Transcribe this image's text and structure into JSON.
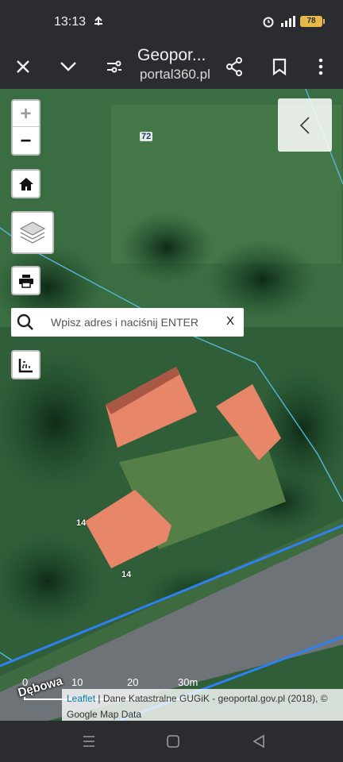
{
  "status_bar": {
    "time": "13:13",
    "battery": "78"
  },
  "toolbar": {
    "title": "Geopor...",
    "url": "portal360.pl"
  },
  "map": {
    "zoom_in": "+",
    "zoom_out": "−",
    "search": {
      "placeholder": "Wpisz adres i naciśnij ENTER",
      "clear": "X"
    },
    "parcel_labels": [
      "72",
      "14",
      "14"
    ],
    "street_name": "Dębowa",
    "scale_labels": [
      "0",
      "10",
      "20",
      "30m"
    ],
    "attribution": {
      "leaflet": "Leaflet",
      "text": " | Dane Katastralne GUGiK - geoportal.gov.pl (2018), © Google Map Data"
    }
  },
  "colors": {
    "parcel_line": "#57b6d8",
    "road_line": "#2f80f0",
    "roof": "#e8866a"
  }
}
